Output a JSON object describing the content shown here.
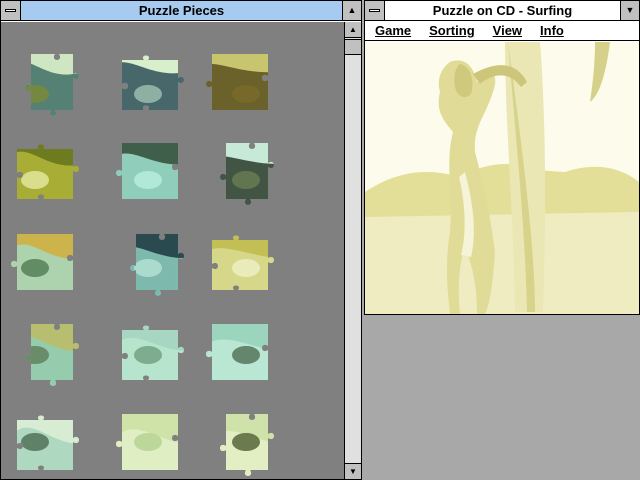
{
  "pieces_window": {
    "title": "Puzzle Pieces",
    "system_menu_icon": "system-menu-icon",
    "minimize_icon": "minimize-icon",
    "scroll_up_icon": "scroll-up-arrow-icon",
    "scroll_down_icon": "scroll-down-arrow-icon"
  },
  "game_window": {
    "title": "Puzzle on CD - Surfing",
    "system_menu_icon": "system-menu-icon",
    "minimize_icon": "minimize-icon",
    "menu": [
      "Game",
      "Sorting",
      "View",
      "Info"
    ]
  },
  "colors": {
    "desktop": "#a8a8a8",
    "pieces_bg": "#808080",
    "active_title": "#a6caf0",
    "photo_tint": "#e9e6a6"
  }
}
